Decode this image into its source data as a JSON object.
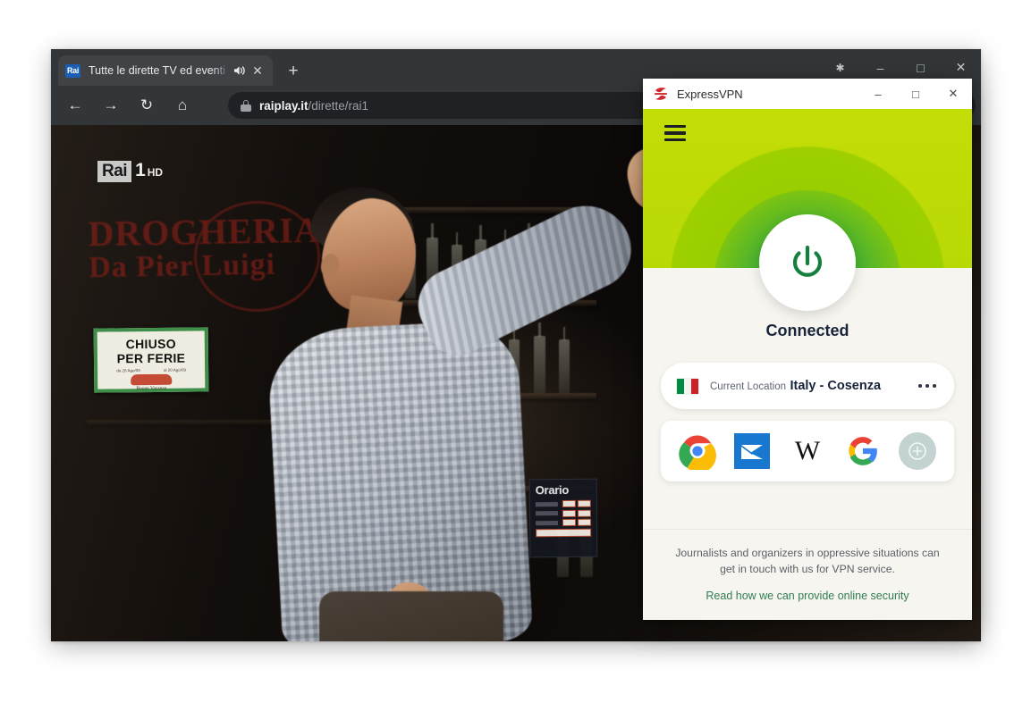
{
  "browser": {
    "tab": {
      "favicon_text": "Rai",
      "favicon_icon": "rai-logo-icon",
      "title": "Tutte le dirette TV ed eventi",
      "audio_icon": "speaker-playing-icon",
      "close_icon": "close-icon"
    },
    "new_tab_icon": "plus-icon",
    "window_controls": [
      {
        "name": "chevron-down",
        "glyph": "⌄"
      },
      {
        "name": "minimize",
        "glyph": "–"
      },
      {
        "name": "maximize",
        "glyph": "□"
      },
      {
        "name": "close",
        "glyph": "✕"
      }
    ],
    "toolbar": {
      "back_icon": "←",
      "forward_icon": "→",
      "reload_icon": "↻",
      "home_icon": "⌂",
      "lock_icon": "lock-icon",
      "url_host": "raiplay.it",
      "url_path": "/dirette/rai1"
    }
  },
  "video": {
    "watermark": {
      "network": "Rai",
      "channel": "1",
      "quality": "HD"
    },
    "shop_sign": {
      "line1": "DROGHERIA",
      "line2": "Da Pier Luigi"
    },
    "placard": {
      "line1": "CHIUSO",
      "line2": "PER FERIE",
      "from": "da 28 Ago/09",
      "to": "al 20 Ago/09",
      "note": "Buone Vacanze"
    },
    "hours_sign": {
      "title": "Orario"
    }
  },
  "vpn": {
    "app_name": "ExpressVPN",
    "logo_icon": "expressvpn-logo-icon",
    "menu_icon": "hamburger-menu-icon",
    "window_controls": [
      {
        "name": "minimize",
        "glyph": "–"
      },
      {
        "name": "maximize",
        "glyph": "□"
      },
      {
        "name": "close",
        "glyph": "✕"
      }
    ],
    "power_icon": "power-button-icon",
    "status": "Connected",
    "location": {
      "flag_icon": "italy-flag-icon",
      "label": "Current Location",
      "name": "Italy - Cosenza",
      "options_icon": "more-options-icon"
    },
    "shortcuts": [
      {
        "name": "chrome-icon",
        "label": "Chrome"
      },
      {
        "name": "mail-icon",
        "label": "Mail"
      },
      {
        "name": "wikipedia-icon",
        "label": "W"
      },
      {
        "name": "google-icon",
        "label": "Google"
      },
      {
        "name": "add-shortcut-icon",
        "label": "Add"
      }
    ],
    "footer": {
      "note": "Journalists and organizers in oppressive situations can get in touch with us for VPN service.",
      "link": "Read how we can provide online security"
    }
  },
  "colors": {
    "vpn_green_light": "#c3dd07",
    "vpn_green_mid": "#8dc900",
    "vpn_green_dark": "#3aaa35",
    "vpn_red": "#d12630",
    "link_green": "#2f7d52",
    "browser_chrome": "#323639",
    "omnibox": "#202124"
  }
}
